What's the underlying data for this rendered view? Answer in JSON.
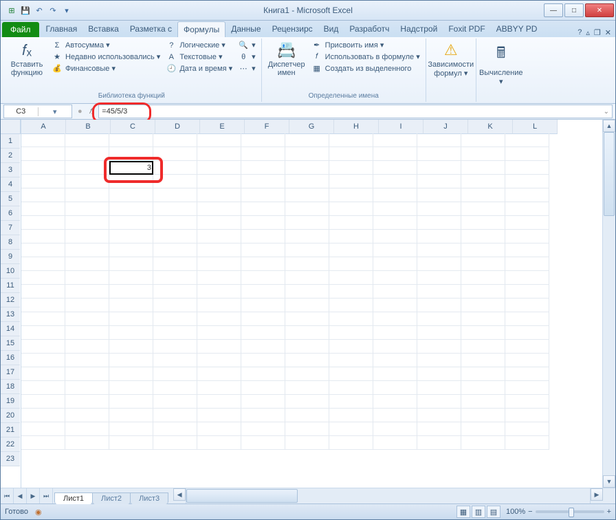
{
  "window": {
    "title": "Книга1 - Microsoft Excel"
  },
  "qat": {
    "items": [
      "excel-icon",
      "save-icon",
      "undo-icon",
      "redo-icon",
      "doc-icon"
    ]
  },
  "winbuttons": {
    "min": "—",
    "max": "□",
    "close": "✕"
  },
  "tabs": {
    "file": "Файл",
    "list": [
      "Главная",
      "Вставка",
      "Разметка с",
      "Формулы",
      "Данные",
      "Рецензирс",
      "Вид",
      "Разработч",
      "Надстрой",
      "Foxit PDF",
      "ABBYY PD"
    ],
    "active": 3,
    "help_icons": [
      "help-icon",
      "minimize-ribbon-icon",
      "restore-icon",
      "close-doc-icon"
    ]
  },
  "ribbon": {
    "group1": {
      "title": "Библиотека функций",
      "insert_fn": {
        "icon": "𝑓ₓ",
        "label": "Вставить функцию"
      },
      "col1": [
        {
          "icon": "Σ",
          "label": "Автосумма ▾"
        },
        {
          "icon": "★",
          "label": "Недавно использовались ▾"
        },
        {
          "icon": "💰",
          "label": "Финансовые ▾"
        }
      ],
      "col2": [
        {
          "icon": "?",
          "label": "Логические ▾"
        },
        {
          "icon": "A",
          "label": "Текстовые ▾"
        },
        {
          "icon": "🕘",
          "label": "Дата и время ▾"
        }
      ],
      "col3": [
        {
          "icon": "🔍",
          "label": "▾"
        },
        {
          "icon": "θ",
          "label": "▾"
        },
        {
          "icon": "⋯",
          "label": "▾"
        }
      ]
    },
    "group2": {
      "title": "Определенные имена",
      "name_mgr": {
        "icon": "📇",
        "label": "Диспетчер имен"
      },
      "rows": [
        {
          "icon": "✒",
          "label": "Присвоить имя ▾"
        },
        {
          "icon": "𝑓",
          "label": "Использовать в формуле ▾"
        },
        {
          "icon": "▦",
          "label": "Создать из выделенного"
        }
      ]
    },
    "group3": {
      "btn": {
        "icon": "⚠",
        "label": "Зависимости формул ▾"
      }
    },
    "group4": {
      "btn": {
        "icon": "🖩",
        "label": "Вычисление ▾"
      }
    }
  },
  "namebox": {
    "cell": "C3"
  },
  "formula_bar": {
    "fx": "𝑓ₓ",
    "value": "=45/5/3"
  },
  "grid": {
    "columns": [
      "A",
      "B",
      "C",
      "D",
      "E",
      "F",
      "G",
      "H",
      "I",
      "J",
      "K",
      "L"
    ],
    "rows": 23,
    "active": {
      "row": 3,
      "col": "C",
      "value": "3"
    }
  },
  "sheets": {
    "tabs": [
      "Лист1",
      "Лист2",
      "Лист3"
    ],
    "active": 0,
    "nav": [
      "⏮",
      "◀",
      "▶",
      "⏭"
    ]
  },
  "status": {
    "ready": "Готово",
    "zoom": "100%",
    "zoom_minus": "−",
    "zoom_plus": "+"
  }
}
